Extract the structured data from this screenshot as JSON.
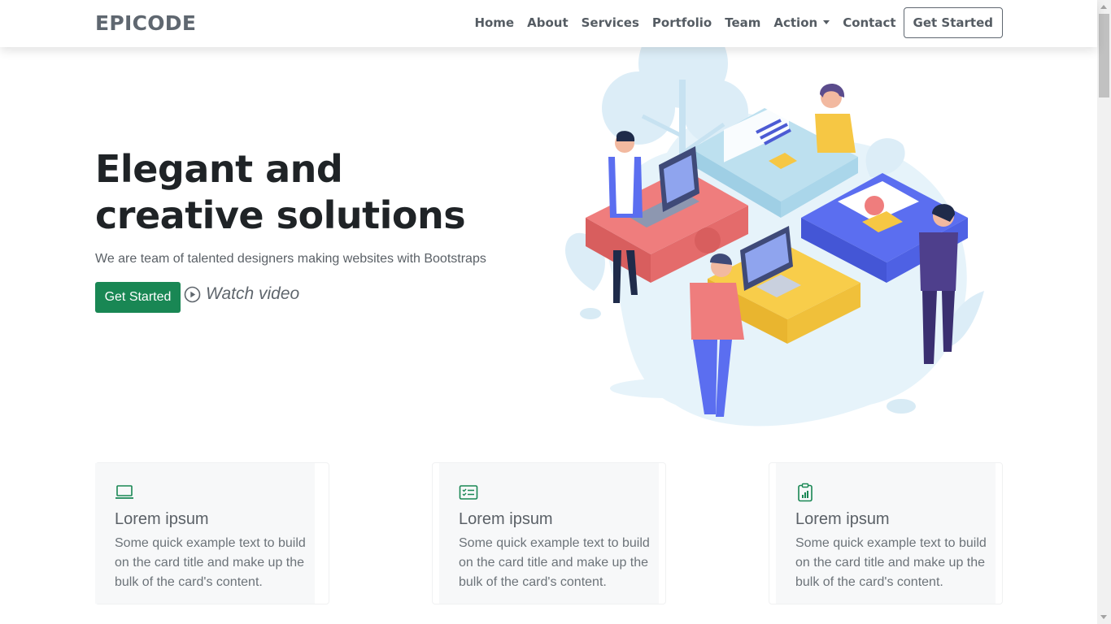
{
  "navbar": {
    "brand": "EPICODE",
    "links": [
      "Home",
      "About",
      "Services",
      "Portfolio",
      "Team",
      "Action",
      "Contact"
    ],
    "cta": "Get Started"
  },
  "hero": {
    "title": "Elegant and creative solutions",
    "subtitle": "We are team of talented designers making websites with Bootstraps",
    "primary_button": "Get Started",
    "video_link": "Watch video",
    "illustration": "team-puzzle-illustration"
  },
  "cards": [
    {
      "icon": "laptop-icon",
      "title": "Lorem ipsum",
      "text": "Some quick example text to build on the card title and make up the bulk of the card's content."
    },
    {
      "icon": "list-card-icon",
      "title": "Lorem ipsum",
      "text": "Some quick example text to build on the card title and make up the bulk of the card's content."
    },
    {
      "icon": "clipboard-chart-icon",
      "title": "Lorem ipsum",
      "text": "Some quick example text to build on the card title and make up the bulk of the card's content."
    }
  ],
  "colors": {
    "accent": "#198754",
    "nav_text": "#555c63",
    "heading": "#1f2326",
    "card_bg": "#f7f8f9"
  }
}
